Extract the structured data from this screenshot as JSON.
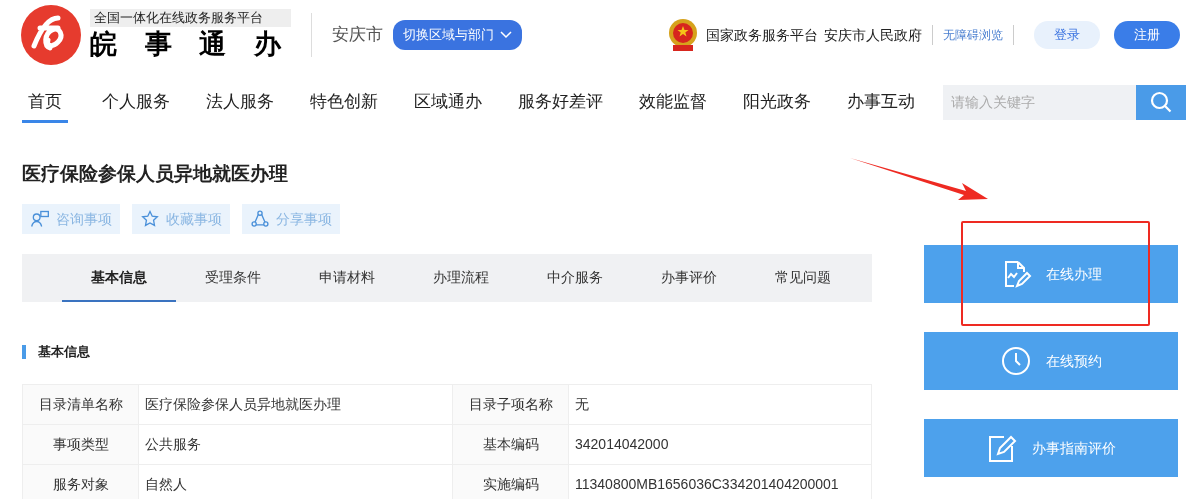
{
  "brand": {
    "tagline": "全国一体化在线政务服务平台",
    "name": "皖 事 通 办"
  },
  "region": {
    "city": "安庆市",
    "switch_label": "切换区域与部门"
  },
  "top_links": {
    "national": "国家政务服务平台",
    "city_gov": "安庆市人民政府",
    "accessibility": "无障碍浏览",
    "login": "登录",
    "register": "注册"
  },
  "nav": [
    {
      "label": "首页",
      "selected": true
    },
    {
      "label": "个人服务",
      "selected": false
    },
    {
      "label": "法人服务",
      "selected": false
    },
    {
      "label": "特色创新",
      "selected": false
    },
    {
      "label": "区域通办",
      "selected": false
    },
    {
      "label": "服务好差评",
      "selected": false
    },
    {
      "label": "效能监督",
      "selected": false
    },
    {
      "label": "阳光政务",
      "selected": false
    },
    {
      "label": "办事互动",
      "selected": false
    }
  ],
  "search": {
    "placeholder": "请输入关键字"
  },
  "title": "医疗保险参保人员异地就医办理",
  "actions": [
    {
      "kind": "consult",
      "label": "咨询事项"
    },
    {
      "kind": "favorite",
      "label": "收藏事项"
    },
    {
      "kind": "share",
      "label": "分享事项"
    }
  ],
  "tabs": [
    {
      "label": "基本信息",
      "selected": true
    },
    {
      "label": "受理条件",
      "selected": false
    },
    {
      "label": "申请材料",
      "selected": false
    },
    {
      "label": "办理流程",
      "selected": false
    },
    {
      "label": "中介服务",
      "selected": false
    },
    {
      "label": "办事评价",
      "selected": false
    },
    {
      "label": "常见问题",
      "selected": false
    }
  ],
  "section_title": "基本信息",
  "table": {
    "rows": [
      [
        "目录清单名称",
        "医疗保险参保人员异地就医办理",
        "目录子项名称",
        "无"
      ],
      [
        "事项类型",
        "公共服务",
        "基本编码",
        "342014042000"
      ],
      [
        "服务对象",
        "自然人",
        "实施编码",
        "11340800MB1656036C334201404200001"
      ]
    ]
  },
  "side_buttons": [
    {
      "kind": "online",
      "label": "在线办理"
    },
    {
      "kind": "appointment",
      "label": "在线预约"
    },
    {
      "kind": "review",
      "label": "办事指南评价"
    }
  ],
  "annotation": {
    "arrow": true,
    "highlight_box": true
  }
}
